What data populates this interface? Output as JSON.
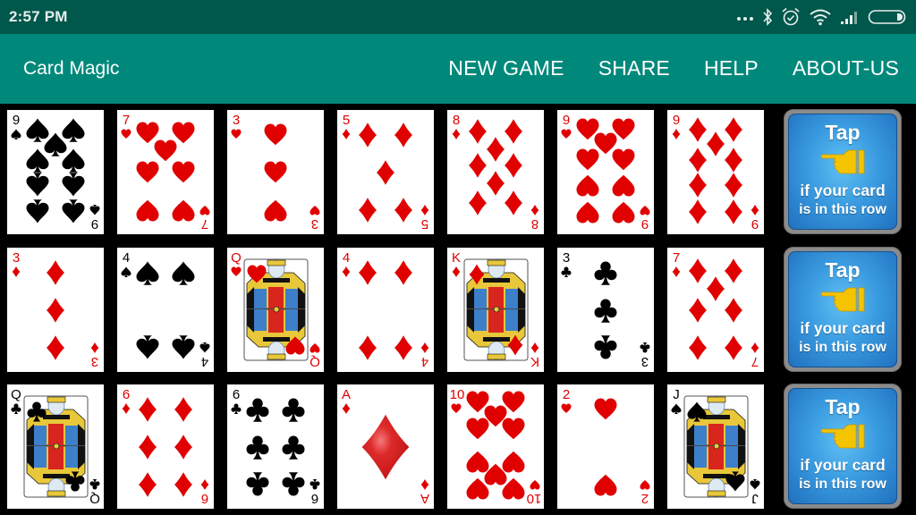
{
  "status_bar": {
    "time": "2:57 PM",
    "icons": [
      "more-dots-icon",
      "bluetooth-icon",
      "alarm-icon",
      "wifi-icon",
      "signal-icon",
      "battery-icon"
    ]
  },
  "app_bar": {
    "title": "Card Magic",
    "menu": [
      {
        "id": "new-game",
        "label": "NEW GAME"
      },
      {
        "id": "share",
        "label": "SHARE"
      },
      {
        "id": "help",
        "label": "HELP"
      },
      {
        "id": "about-us",
        "label": "ABOUT-US"
      }
    ]
  },
  "colors": {
    "status_bar": "#00574B",
    "app_bar": "#00897B",
    "red_suit": "#E00000",
    "black_suit": "#000000",
    "button_blue": "#3A9BE0",
    "hand_yellow": "#F5C400"
  },
  "rows": [
    {
      "cards": [
        {
          "rank": "9",
          "suit": "spades"
        },
        {
          "rank": "7",
          "suit": "hearts"
        },
        {
          "rank": "3",
          "suit": "hearts"
        },
        {
          "rank": "5",
          "suit": "diamonds"
        },
        {
          "rank": "8",
          "suit": "diamonds"
        },
        {
          "rank": "9",
          "suit": "hearts"
        },
        {
          "rank": "9",
          "suit": "diamonds"
        }
      ],
      "tap_button": {
        "title": "Tap",
        "line1": "if your card",
        "line2": "is in this row"
      }
    },
    {
      "cards": [
        {
          "rank": "3",
          "suit": "diamonds"
        },
        {
          "rank": "4",
          "suit": "spades"
        },
        {
          "rank": "Q",
          "suit": "hearts"
        },
        {
          "rank": "4",
          "suit": "diamonds"
        },
        {
          "rank": "K",
          "suit": "diamonds"
        },
        {
          "rank": "3",
          "suit": "clubs"
        },
        {
          "rank": "7",
          "suit": "diamonds"
        }
      ],
      "tap_button": {
        "title": "Tap",
        "line1": "if your card",
        "line2": "is in this row"
      }
    },
    {
      "cards": [
        {
          "rank": "Q",
          "suit": "clubs"
        },
        {
          "rank": "6",
          "suit": "diamonds"
        },
        {
          "rank": "6",
          "suit": "clubs"
        },
        {
          "rank": "A",
          "suit": "diamonds"
        },
        {
          "rank": "10",
          "suit": "hearts"
        },
        {
          "rank": "2",
          "suit": "hearts"
        },
        {
          "rank": "J",
          "suit": "spades"
        }
      ],
      "tap_button": {
        "title": "Tap",
        "line1": "if your card",
        "line2": "is in this row"
      }
    }
  ]
}
